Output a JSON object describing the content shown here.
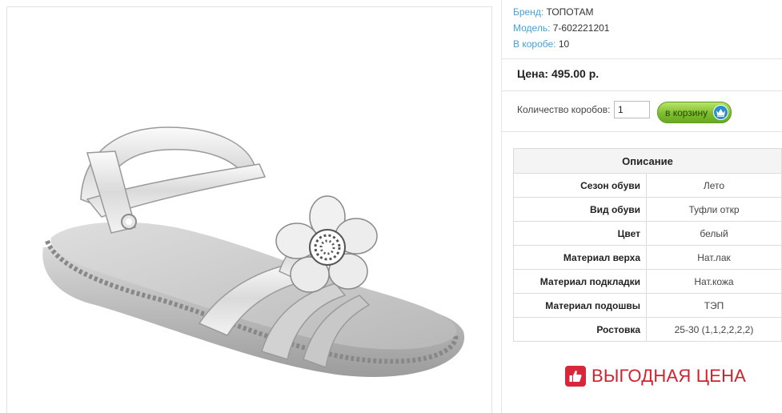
{
  "product": {
    "image_alt": "white sandal with flower",
    "brand_label": "Бренд:",
    "brand": "ТОПОТАМ",
    "model_label": "Модель:",
    "model": "7-602221201",
    "box_label": "В коробе:",
    "box": "10",
    "price": "Цена: 495.00 р."
  },
  "order": {
    "qty_label": "Количество коробов:",
    "qty_value": "1",
    "cart_button": "в корзину"
  },
  "specs": {
    "header": "Описание",
    "rows": [
      {
        "key": "Сезон обуви",
        "value": "Лето"
      },
      {
        "key": "Вид обуви",
        "value": "Туфли откр"
      },
      {
        "key": "Цвет",
        "value": "белый"
      },
      {
        "key": "Материал верха",
        "value": "Нат.лак"
      },
      {
        "key": "Материал подкладки",
        "value": "Нат.кожа"
      },
      {
        "key": "Материал подошвы",
        "value": "ТЭП"
      },
      {
        "key": "Ростовка",
        "value": "25-30 (1,1,2,2,2,2)"
      }
    ]
  },
  "promo": {
    "text": "ВЫГОДНАЯ ЦЕНА",
    "icon": "thumbs-up-icon",
    "color": "#d3202f"
  },
  "colors": {
    "label_blue": "#4a9fd5",
    "button_green": "#7fbd2e"
  }
}
